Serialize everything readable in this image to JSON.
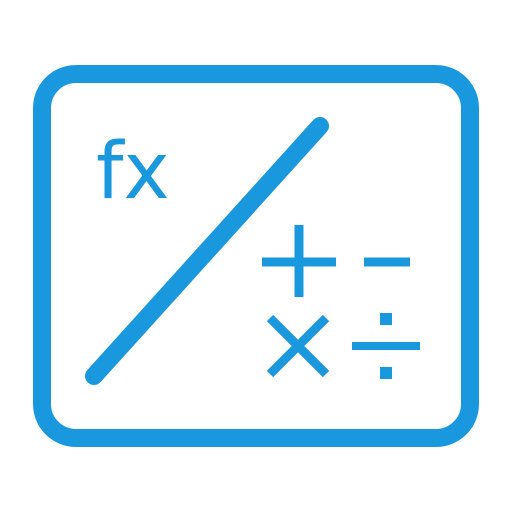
{
  "icon": {
    "name": "formula-icon",
    "color": "#1a98dd",
    "function_label": "fx",
    "symbols": [
      "plus-icon",
      "minus-icon",
      "multiply-icon",
      "divide-icon"
    ]
  }
}
